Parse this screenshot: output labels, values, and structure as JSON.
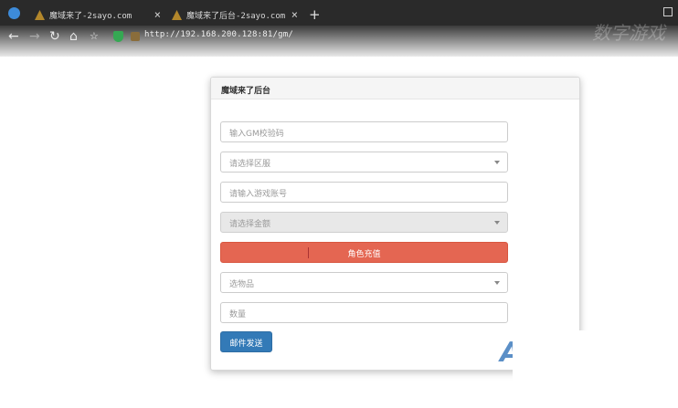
{
  "browser": {
    "tabs": [
      {
        "title": "魔域来了-2sayo.com"
      },
      {
        "title": "魔域来了后台-2sayo.com"
      }
    ],
    "new_tab": "+",
    "close": "×",
    "url": "http://192.168.200.128:81/gm/",
    "nav_icons": [
      "back-icon",
      "forward-icon",
      "reload-icon",
      "home-icon",
      "favorites-icon"
    ],
    "watermark": "数字游戏"
  },
  "panel": {
    "title": "魔域来了后台",
    "gm_code_placeholder": "输入GM校验码",
    "server_select": "请选择区服",
    "account_placeholder": "请输入游戏账号",
    "amount_select": "请选择金额",
    "recharge_button": "角色充值",
    "item_select": "选物品",
    "quantity_placeholder": "数量",
    "send_mail_button": "邮件发送"
  },
  "colors": {
    "recharge": "#e46652",
    "send": "#337ab7"
  }
}
